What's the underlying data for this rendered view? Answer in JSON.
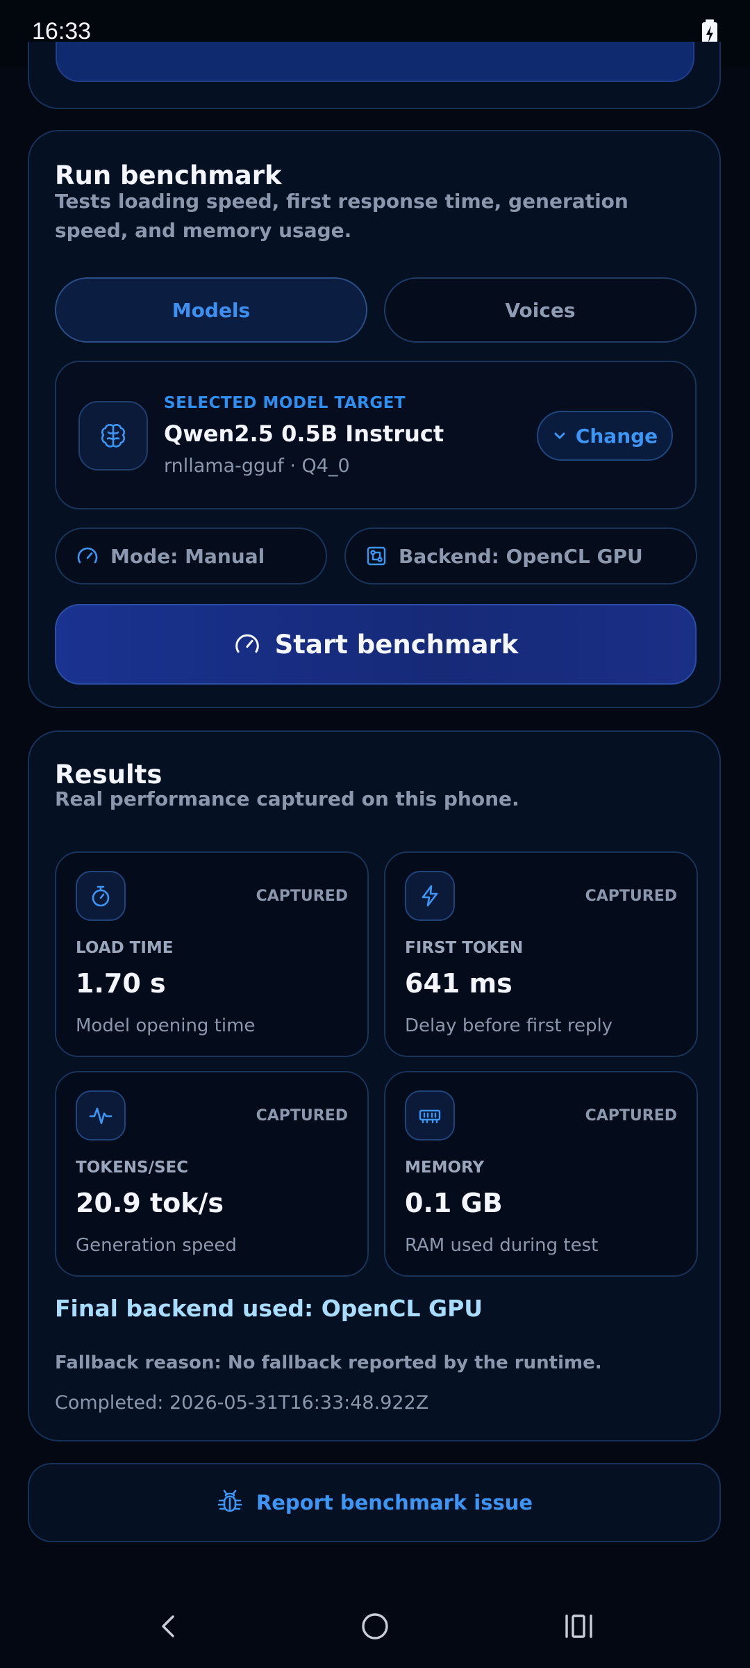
{
  "status_bar": {
    "time": "16:33",
    "battery_icon": "battery-charging-icon"
  },
  "run": {
    "title": "Run benchmark",
    "subtitle": "Tests loading speed, first response time, generation speed, and memory usage.",
    "tabs": [
      {
        "label": "Models",
        "selected": true
      },
      {
        "label": "Voices",
        "selected": false
      }
    ],
    "model": {
      "icon": "brain-icon",
      "kicker": "SELECTED MODEL TARGET",
      "name": "Qwen2.5 0.5B Instruct",
      "meta": "rnllama-gguf · Q4_0",
      "change_label": "Change"
    },
    "mode_label": "Mode: Manual",
    "backend_label": "Backend: OpenCL GPU",
    "start_label": "Start benchmark"
  },
  "results": {
    "title": "Results",
    "subtitle": "Real performance captured on this phone.",
    "metrics": [
      {
        "icon": "stopwatch-icon",
        "badge": "CAPTURED",
        "label": "LOAD TIME",
        "value": "1.70 s",
        "desc": "Model opening time"
      },
      {
        "icon": "lightning-icon",
        "badge": "CAPTURED",
        "label": "FIRST TOKEN",
        "value": "641 ms",
        "desc": "Delay before first reply"
      },
      {
        "icon": "pulse-icon",
        "badge": "CAPTURED",
        "label": "TOKENS/SEC",
        "value": "20.9 tok/s",
        "desc": "Generation speed"
      },
      {
        "icon": "memory-icon",
        "badge": "CAPTURED",
        "label": "MEMORY",
        "value": "0.1 GB",
        "desc": "RAM used during test"
      }
    ],
    "final_backend": "Final backend used: OpenCL GPU",
    "fallback": "Fallback reason: No fallback reported by the runtime.",
    "completed": "Completed: 2026-05-31T16:33:48.922Z"
  },
  "report": {
    "label": "Report benchmark issue",
    "icon": "bug-icon"
  },
  "colors": {
    "accent": "#3d95f5",
    "background": "#030812",
    "card": "#061023",
    "button": "#1a3290"
  }
}
